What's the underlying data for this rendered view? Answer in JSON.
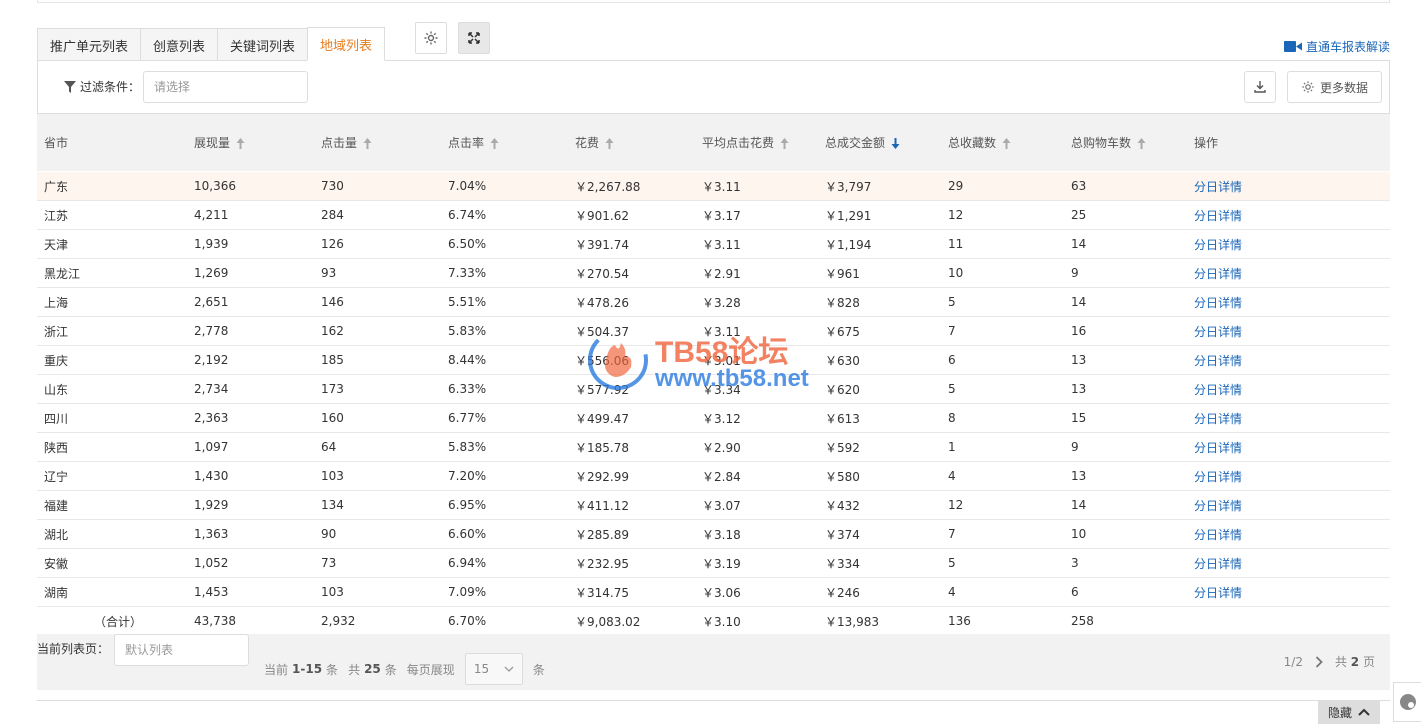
{
  "tabs": [
    "推广单元列表",
    "创意列表",
    "关键词列表",
    "地域列表"
  ],
  "active_tab": 3,
  "report_link": "直通车报表解读",
  "filter": {
    "label": "过滤条件：",
    "placeholder": "请选择"
  },
  "more_data": "更多数据",
  "columns": [
    "省市",
    "展现量",
    "点击量",
    "点击率",
    "花费",
    "平均点击花费",
    "总成交金额",
    "总收藏数",
    "总购物车数",
    "操作"
  ],
  "rows": [
    [
      "广东",
      "10,366",
      "730",
      "7.04%",
      "￥2,267.88",
      "￥3.11",
      "￥3,797",
      "29",
      "63",
      "分日详情"
    ],
    [
      "江苏",
      "4,211",
      "284",
      "6.74%",
      "￥901.62",
      "￥3.17",
      "￥1,291",
      "12",
      "25",
      "分日详情"
    ],
    [
      "天津",
      "1,939",
      "126",
      "6.50%",
      "￥391.74",
      "￥3.11",
      "￥1,194",
      "11",
      "14",
      "分日详情"
    ],
    [
      "黑龙江",
      "1,269",
      "93",
      "7.33%",
      "￥270.54",
      "￥2.91",
      "￥961",
      "10",
      "9",
      "分日详情"
    ],
    [
      "上海",
      "2,651",
      "146",
      "5.51%",
      "￥478.26",
      "￥3.28",
      "￥828",
      "5",
      "14",
      "分日详情"
    ],
    [
      "浙江",
      "2,778",
      "162",
      "5.83%",
      "￥504.37",
      "￥3.11",
      "￥675",
      "7",
      "16",
      "分日详情"
    ],
    [
      "重庆",
      "2,192",
      "185",
      "8.44%",
      "￥556.06",
      "￥3.01",
      "￥630",
      "6",
      "13",
      "分日详情"
    ],
    [
      "山东",
      "2,734",
      "173",
      "6.33%",
      "￥577.92",
      "￥3.34",
      "￥620",
      "5",
      "13",
      "分日详情"
    ],
    [
      "四川",
      "2,363",
      "160",
      "6.77%",
      "￥499.47",
      "￥3.12",
      "￥613",
      "8",
      "15",
      "分日详情"
    ],
    [
      "陕西",
      "1,097",
      "64",
      "5.83%",
      "￥185.78",
      "￥2.90",
      "￥592",
      "1",
      "9",
      "分日详情"
    ],
    [
      "辽宁",
      "1,430",
      "103",
      "7.20%",
      "￥292.99",
      "￥2.84",
      "￥580",
      "4",
      "13",
      "分日详情"
    ],
    [
      "福建",
      "1,929",
      "134",
      "6.95%",
      "￥411.12",
      "￥3.07",
      "￥432",
      "12",
      "14",
      "分日详情"
    ],
    [
      "湖北",
      "1,363",
      "90",
      "6.60%",
      "￥285.89",
      "￥3.18",
      "￥374",
      "7",
      "10",
      "分日详情"
    ],
    [
      "安徽",
      "1,052",
      "73",
      "6.94%",
      "￥232.95",
      "￥3.19",
      "￥334",
      "5",
      "3",
      "分日详情"
    ],
    [
      "湖南",
      "1,453",
      "103",
      "7.09%",
      "￥314.75",
      "￥3.06",
      "￥246",
      "4",
      "6",
      "分日详情"
    ]
  ],
  "total": [
    "（合计）",
    "43,738",
    "2,932",
    "6.70%",
    "￥9,083.02",
    "￥3.10",
    "￥13,983",
    "136",
    "258"
  ],
  "footer": {
    "label": "当前列表页：",
    "input_placeholder": "默认列表",
    "current_prefix": "当前",
    "current_range": "1-15",
    "current_suffix": "条",
    "total_prefix": "共",
    "total_count": "25",
    "total_suffix": "条",
    "per_page_label": "每页展现",
    "per_page_value": "15",
    "per_page_suffix": "条",
    "page_indicator": "1/2",
    "pages_prefix": "共",
    "pages_count": "2",
    "pages_suffix": "页"
  },
  "hide_button": "隐藏",
  "watermark": {
    "line1": "TB58论坛",
    "line2": "www.tb58.net"
  },
  "colors": {
    "accent": "#e67e22",
    "link": "#1a66b8",
    "highlight_row": "#fdf5ee",
    "sort_active": "#1a66b8",
    "sort_inactive": "#aaaaaa"
  }
}
